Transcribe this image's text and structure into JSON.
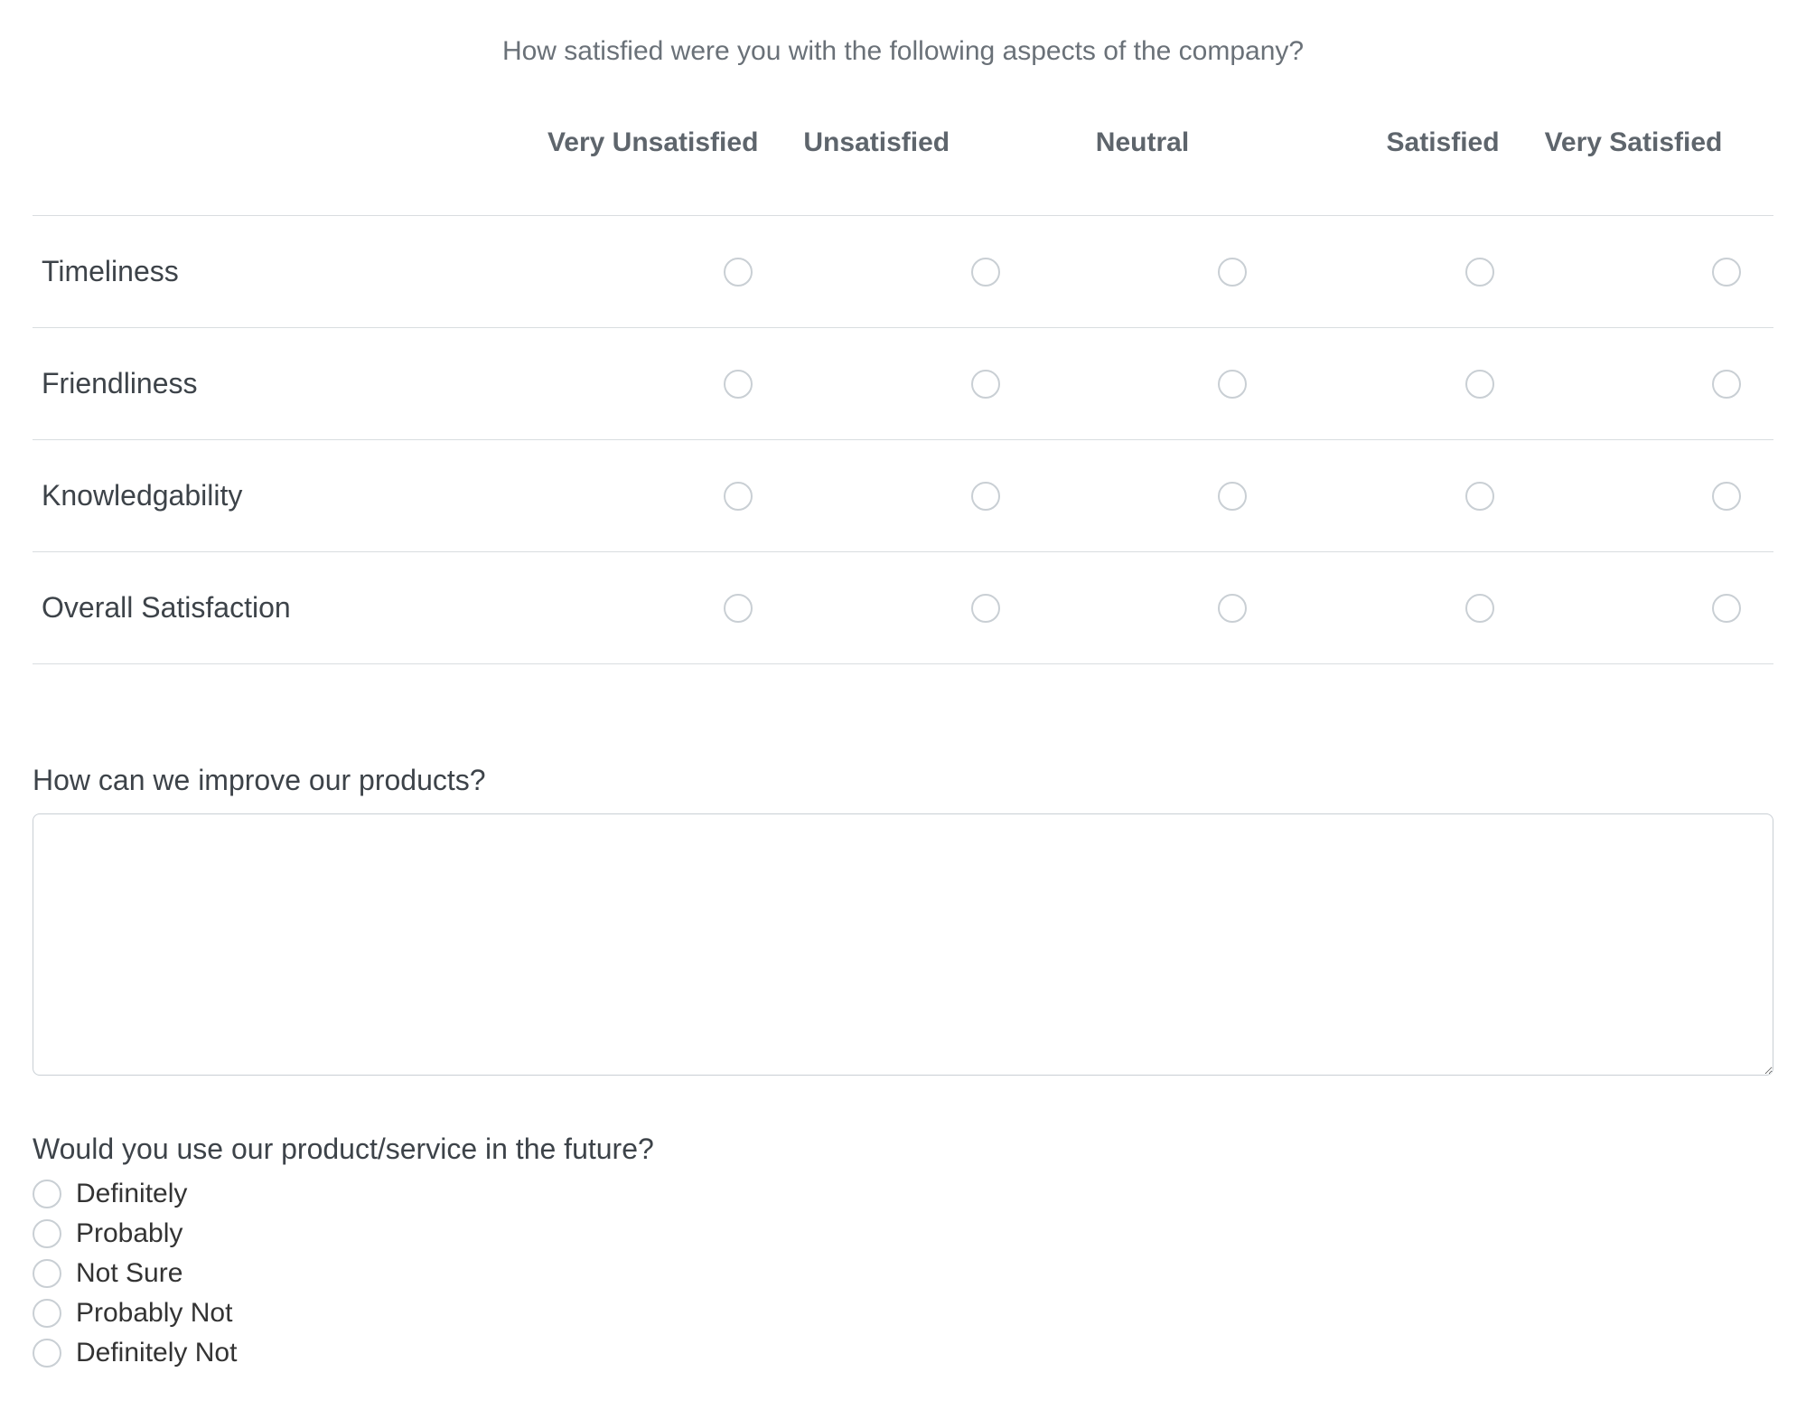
{
  "matrix": {
    "question": "How satisfied were you with the following aspects of the company?",
    "columns": [
      "Very Unsatisfied",
      "Unsatisfied",
      "Neutral",
      "Satisfied",
      "Very Satisfied"
    ],
    "rows": [
      "Timeliness",
      "Friendliness",
      "Knowledgability",
      "Overall Satisfaction"
    ]
  },
  "open": {
    "question": "How can we improve our products?",
    "value": "",
    "placeholder": ""
  },
  "future": {
    "question": "Would you use our product/service in the future?",
    "options": [
      "Definitely",
      "Probably",
      "Not Sure",
      "Probably Not",
      "Definitely Not"
    ]
  }
}
